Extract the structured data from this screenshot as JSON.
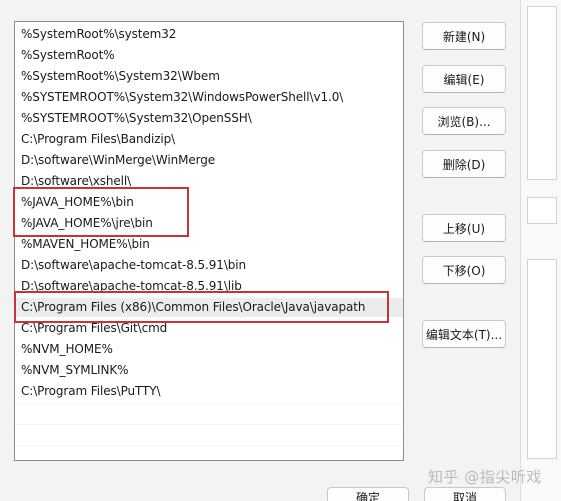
{
  "path_list": {
    "items": [
      "%SystemRoot%\\system32",
      "%SystemRoot%",
      "%SystemRoot%\\System32\\Wbem",
      "%SYSTEMROOT%\\System32\\WindowsPowerShell\\v1.0\\",
      "%SYSTEMROOT%\\System32\\OpenSSH\\",
      "C:\\Program Files\\Bandizip\\",
      "D:\\software\\WinMerge\\WinMerge",
      "D:\\software\\xshell\\",
      "%JAVA_HOME%\\bin",
      "%JAVA_HOME%\\jre\\bin",
      "%MAVEN_HOME%\\bin",
      "D:\\software\\apache-tomcat-8.5.91\\bin",
      "D:\\software\\apache-tomcat-8.5.91\\lib",
      "C:\\Program Files (x86)\\Common Files\\Oracle\\Java\\javapath",
      "C:\\Program Files\\Git\\cmd",
      "%NVM_HOME%",
      "%NVM_SYMLINK%",
      "C:\\Program Files\\PuTTY\\"
    ],
    "selected_index": 13
  },
  "buttons": {
    "new": "新建(N)",
    "edit": "编辑(E)",
    "browse": "浏览(B)...",
    "delete": "删除(D)",
    "move_up": "上移(U)",
    "move_down": "下移(O)",
    "edit_text": "编辑文本(T)..."
  },
  "dialog": {
    "ok": "确定",
    "cancel": "取消"
  },
  "watermark": "知乎 @指尖听戏",
  "colors": {
    "annotation": "#c8333a",
    "selection": "#ececec",
    "background": "#f3f3f3"
  }
}
